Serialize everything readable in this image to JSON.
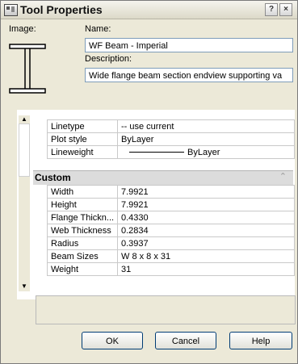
{
  "window": {
    "title": "Tool Properties",
    "help_glyph": "?",
    "close_glyph": "×"
  },
  "image_label": "Image:",
  "name": {
    "label": "Name:",
    "value": "WF Beam - Imperial"
  },
  "description": {
    "label": "Description:",
    "value": "Wide flange beam section endview supporting va"
  },
  "general_rows": [
    {
      "key": "Linetype",
      "value": "-- use current"
    },
    {
      "key": "Plot style",
      "value": "ByLayer"
    },
    {
      "key": "Lineweight",
      "value": "ByLayer"
    }
  ],
  "custom": {
    "title": "Custom",
    "collapse_glyph": "⌃",
    "rows": [
      {
        "key": "Width",
        "value": "7.9921"
      },
      {
        "key": "Height",
        "value": "7.9921"
      },
      {
        "key": "Flange Thickn...",
        "value": "0.4330"
      },
      {
        "key": "Web Thickness",
        "value": "0.2834"
      },
      {
        "key": "Radius",
        "value": "0.3937"
      },
      {
        "key": "Beam Sizes",
        "value": "W 8 x 8 x 31"
      },
      {
        "key": "Weight",
        "value": "31"
      }
    ]
  },
  "scrollbar": {
    "up": "▲",
    "down": "▼"
  },
  "buttons": {
    "ok": "OK",
    "cancel": "Cancel",
    "help": "Help"
  }
}
